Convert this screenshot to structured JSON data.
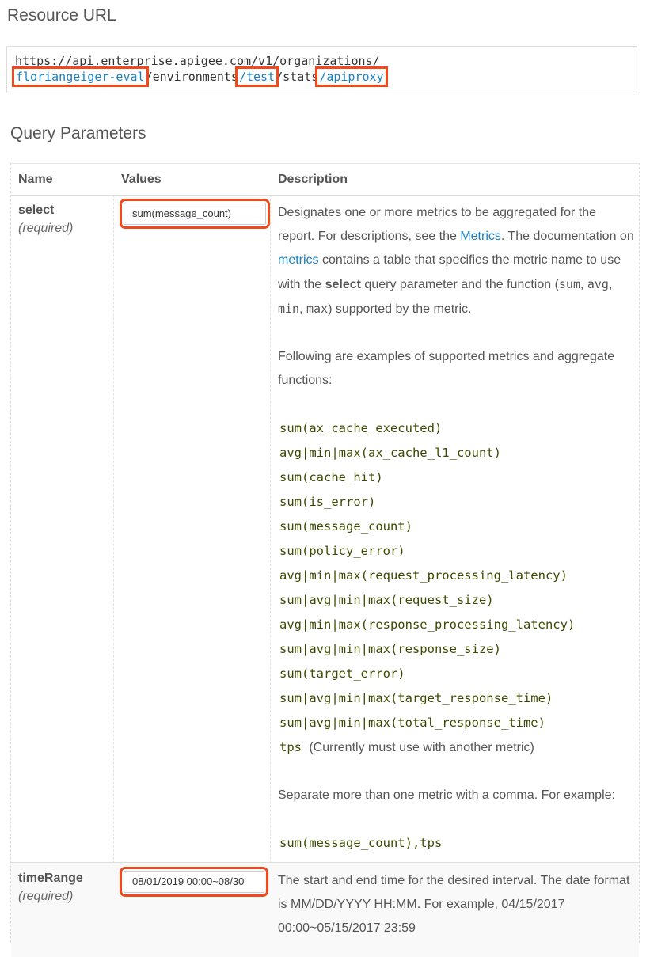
{
  "resource_heading": "Resource URL",
  "url": {
    "prefix": "https://api.enterprise.apigee.com/v1/organizations/",
    "org": "floriangeiger-eval",
    "seg_env": "/environments",
    "slash1": "/",
    "env": "test",
    "seg_stats": "/stats",
    "slash2": "/",
    "dimension": "apiproxy"
  },
  "query_heading": "Query Parameters",
  "table": {
    "col_name": "Name",
    "col_values": "Values",
    "col_description": "Description"
  },
  "params": {
    "select": {
      "name": "select",
      "required": "(required)",
      "value": "sum(message_count)",
      "d1a": "Designates one or more metrics to be aggregated for the report. For descriptions, see the ",
      "d1_link1": "Metrics",
      "d1b": ". The documentation on ",
      "d1_link2": "metrics",
      "d1c": " contains a table that specifies the metric name to use with the ",
      "d1_bold": "select",
      "d1d": " query parameter and the function (",
      "f_sum": "sum",
      "sep1": ", ",
      "f_avg": "avg",
      "sep2": ",",
      "f_min": "min",
      "sep3": ", ",
      "f_max": "max",
      "d1e": ") supported by the metric.",
      "examples_intro": "Following are examples of supported metrics and aggregate functions:",
      "metrics": [
        "sum(ax_cache_executed)",
        "avg|min|max(ax_cache_l1_count)",
        "sum(cache_hit)",
        "sum(is_error)",
        "sum(message_count)",
        "sum(policy_error)",
        "avg|min|max(request_processing_latency)",
        "sum|avg|min|max(request_size)",
        "avg|min|max(response_processing_latency)",
        "sum|avg|min|max(response_size)",
        "sum(target_error)",
        "sum|avg|min|max(target_response_time)",
        "sum|avg|min|max(total_response_time)",
        "tps"
      ],
      "tps_note": "(Currently must use with another metric)",
      "separator_note": "Separate more than one metric with a comma. For example:",
      "example_value": "sum(message_count),tps"
    },
    "timeRange": {
      "name": "timeRange",
      "required": "(required)",
      "value": "08/01/2019 00:00~08/30",
      "desc": "The start and end time for the desired interval. The date format is MM/DD/YYYY HH:MM. For example, 04/15/2017 00:00~05/15/2017 23:59"
    }
  },
  "colors": {
    "highlight": "#f04a1c",
    "link": "#1a7fc1",
    "code": "#3b4a00"
  }
}
